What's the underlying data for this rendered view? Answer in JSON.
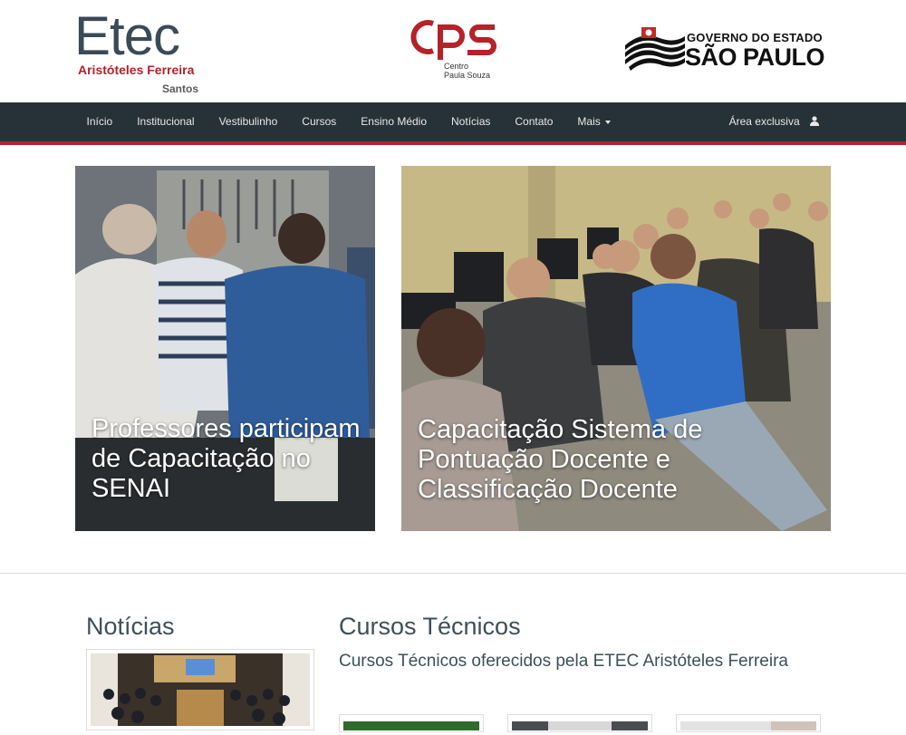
{
  "header": {
    "etec_logo": {
      "word": "Etec",
      "name": "Aristóteles Ferreira",
      "city": "Santos"
    },
    "cps_logo": {
      "letters": "cps",
      "line1": "Centro",
      "line2": "Paula Souza"
    },
    "sp_logo": {
      "line1": "GOVERNO DO ESTADO",
      "line2": "SÃO PAULO"
    }
  },
  "nav": {
    "items": [
      "Início",
      "Institucional",
      "Vestibulinho",
      "Cursos",
      "Ensino Médio",
      "Notícias",
      "Contato",
      "Mais"
    ],
    "right_label": "Área exclusiva",
    "right_icon": "user-icon"
  },
  "hero": [
    {
      "title": "Professores participam de Capacitação no SENAI"
    },
    {
      "title": "Capacitação Sistema de Pontuação Docente e Classificação Docente"
    }
  ],
  "news": {
    "heading": "Notícias"
  },
  "courses": {
    "heading": "Cursos Técnicos",
    "subtitle": "Cursos Técnicos oferecidos pela ETEC Aristóteles Ferreira"
  },
  "colors": {
    "nav_bg": "#263238",
    "accent_red": "#b5222a",
    "heading": "#3d5058"
  }
}
